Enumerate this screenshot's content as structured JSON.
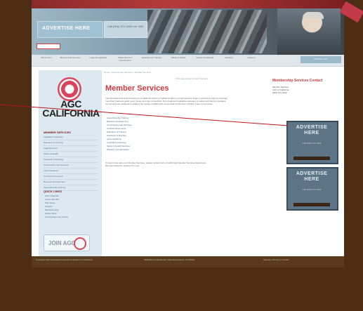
{
  "header": {
    "ad_headline": "ADVERTISE HERE",
    "ad_subtext": "Call (916) 371-2422 ext. 339",
    "search_placeholder": "Search"
  },
  "nav": {
    "items": [
      "About AGC",
      "Membership Services",
      "Legal & Legislative",
      "Public Works & Construction",
      "Education & Training",
      "Safety & Health",
      "Events & Calendar",
      "Districts",
      "Careers"
    ],
    "member_login": "Member Login"
  },
  "breadcrumb": "Home > Membership Services > Member Services",
  "utilities": "Print page   E-mail a friend   Text size",
  "page": {
    "title": "Member Services",
    "intro": [
      "The Associated General Contractors of California (AGC) of California offers a comprehensive range of services to help its members",
      "meet their business goals, save money and stay competitive. From legal and legislative advocacy to safety and training programs,",
      "our services are designed to address the needs of California's commercial construction industry. Learn more below."
    ],
    "services": [
      "Apprenticeship Training",
      "Business Development",
      "Construction Law Services",
      "Contract Documents",
      "Education & Training",
      "Insurance & Bonding",
      "Labor Relations",
      "Legislative Advocacy",
      "Safety & Health Services",
      "Workers' Compensation"
    ],
    "footnote": [
      "To learn more about our Member Services, please contact AGC of California's Member Services department.",
      "We look forward to hearing from you."
    ]
  },
  "sidebar": {
    "logo_line1": "AGC",
    "logo_line2": "CALIFORNIA",
    "section_title": "MEMBER SERVICES",
    "links": [
      "Legislative Advocacy",
      "Education & Training",
      "Legal Services",
      "Safety & Health",
      "Insurance & Bonding",
      "Construction Law Services",
      "Labor Relations",
      "Contract Documents",
      "Business Development",
      "Apprenticeship Training"
    ],
    "quick_title": "QUICK LINKS",
    "quick_links": [
      "AGC Calendar",
      "Find a Member",
      "Plan Room",
      "Careers",
      "Members Only",
      "Online Store",
      "Construction Law Library"
    ],
    "join_label": "JOIN AGC"
  },
  "right_column": {
    "title": "Membership Services Contact",
    "contact": [
      "Member Services",
      "AGC of California",
      "(916) 371-2422"
    ],
    "ad1_title": "ADVERTISE HERE",
    "ad1_sub": "Call (916) 371-2422",
    "ad2_title": "ADVERTISE HERE",
    "ad2_sub": "Call (916) 371-2422"
  },
  "footer": {
    "left": "Copyright 2010 Associated General Contractors of California",
    "middle": "3095 Beacon Boulevard, West Sacramento, CA 95691",
    "right": "Sitemap  |  Privacy  |  Contact"
  },
  "colors": {
    "page_bg": "#4d2e15",
    "accent_red": "#d2363e",
    "sidebar_bg": "#dce9f1",
    "link_blue": "#4a6f8b"
  }
}
